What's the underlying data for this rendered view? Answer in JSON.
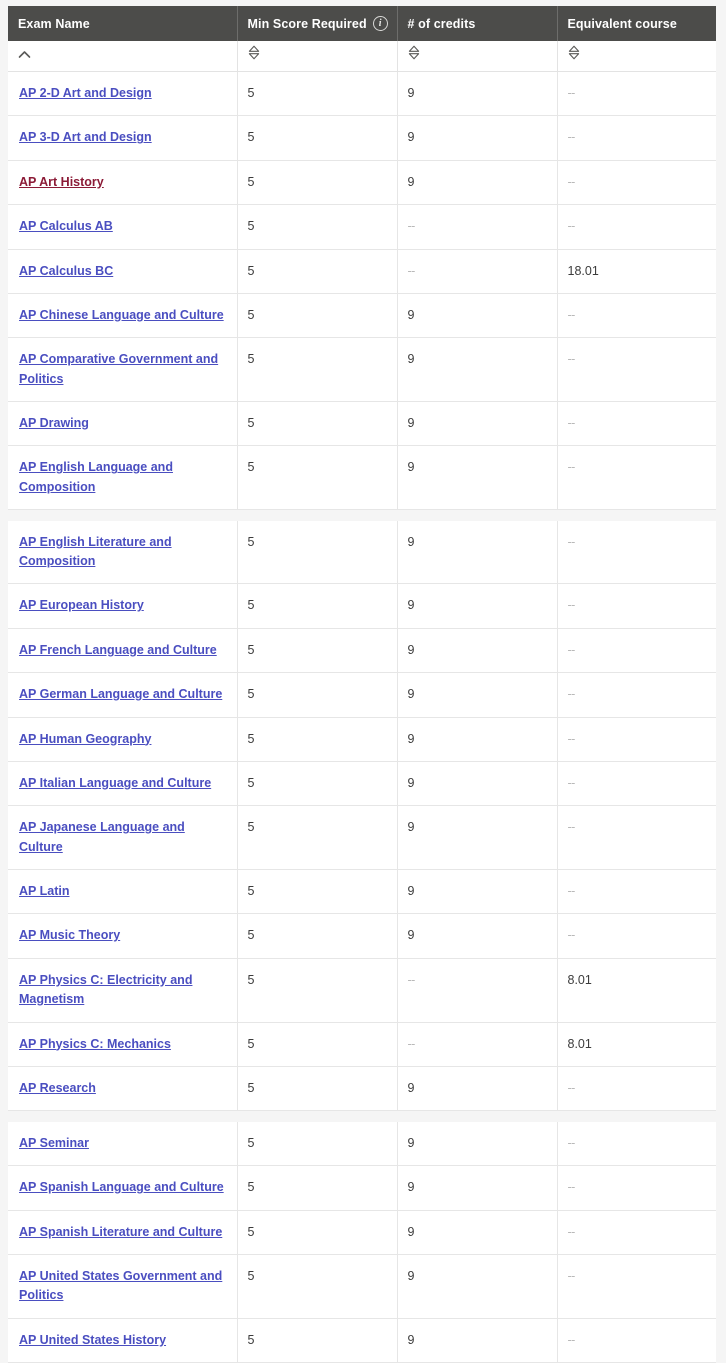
{
  "table": {
    "columns": [
      {
        "label": "Exam Name",
        "sort_icon": "caret-up-icon",
        "sort_state": "ascending",
        "has_info_icon": false
      },
      {
        "label": "Min Score Required",
        "sort_icon": "sort-both-icon",
        "sort_state": "none",
        "has_info_icon": true,
        "info_icon": "info-circle-icon"
      },
      {
        "label": "# of credits",
        "sort_icon": "sort-both-icon",
        "sort_state": "none",
        "has_info_icon": false
      },
      {
        "label": "Equivalent course",
        "sort_icon": "sort-both-icon",
        "sort_state": "none",
        "has_info_icon": false
      }
    ],
    "colors": {
      "header_background": "#4c4c4a",
      "header_text": "#ffffff",
      "link": "#4a4ec0",
      "link_visited": "#8b1a36",
      "cell_text": "#3c3c3c",
      "dash": "#b9b9b9",
      "page_background": "#f5f5f5",
      "row_border": "#e6e6e6"
    },
    "blocks": [
      {
        "rows": [
          {
            "exam": "AP 2-D Art and Design",
            "visited": false,
            "min_score": "5",
            "credits": "9",
            "equivalent": "--"
          },
          {
            "exam": "AP 3-D Art and Design",
            "visited": false,
            "min_score": "5",
            "credits": "9",
            "equivalent": "--"
          },
          {
            "exam": "AP Art History",
            "visited": true,
            "min_score": "5",
            "credits": "9",
            "equivalent": "--"
          },
          {
            "exam": "AP Calculus AB",
            "visited": false,
            "min_score": "5",
            "credits": "--",
            "equivalent": "--"
          },
          {
            "exam": "AP Calculus BC",
            "visited": false,
            "min_score": "5",
            "credits": "--",
            "equivalent": "18.01"
          },
          {
            "exam": "AP Chinese Language and Culture",
            "visited": false,
            "min_score": "5",
            "credits": "9",
            "equivalent": "--"
          },
          {
            "exam": "AP Comparative Government and Politics",
            "visited": false,
            "min_score": "5",
            "credits": "9",
            "equivalent": "--"
          },
          {
            "exam": "AP Drawing",
            "visited": false,
            "min_score": "5",
            "credits": "9",
            "equivalent": "--"
          },
          {
            "exam": "AP English Language and Composition",
            "visited": false,
            "min_score": "5",
            "credits": "9",
            "equivalent": "--"
          }
        ]
      },
      {
        "rows": [
          {
            "exam": "AP English Literature and Composition",
            "visited": false,
            "min_score": "5",
            "credits": "9",
            "equivalent": "--"
          },
          {
            "exam": "AP European History",
            "visited": false,
            "min_score": "5",
            "credits": "9",
            "equivalent": "--"
          },
          {
            "exam": "AP French Language and Culture",
            "visited": false,
            "min_score": "5",
            "credits": "9",
            "equivalent": "--"
          },
          {
            "exam": "AP German Language and Culture",
            "visited": false,
            "min_score": "5",
            "credits": "9",
            "equivalent": "--"
          },
          {
            "exam": "AP Human Geography",
            "visited": false,
            "min_score": "5",
            "credits": "9",
            "equivalent": "--"
          },
          {
            "exam": "AP Italian Language and Culture",
            "visited": false,
            "min_score": "5",
            "credits": "9",
            "equivalent": "--"
          },
          {
            "exam": "AP Japanese Language and Culture",
            "visited": false,
            "min_score": "5",
            "credits": "9",
            "equivalent": "--"
          },
          {
            "exam": "AP Latin",
            "visited": false,
            "min_score": "5",
            "credits": "9",
            "equivalent": "--"
          },
          {
            "exam": "AP Music Theory",
            "visited": false,
            "min_score": "5",
            "credits": "9",
            "equivalent": "--"
          },
          {
            "exam": "AP Physics C: Electricity and Magnetism",
            "visited": false,
            "min_score": "5",
            "credits": "--",
            "equivalent": "8.01"
          },
          {
            "exam": "AP Physics C: Mechanics",
            "visited": false,
            "min_score": "5",
            "credits": "--",
            "equivalent": "8.01"
          },
          {
            "exam": "AP Research",
            "visited": false,
            "min_score": "5",
            "credits": "9",
            "equivalent": "--"
          }
        ]
      },
      {
        "rows": [
          {
            "exam": "AP Seminar",
            "visited": false,
            "min_score": "5",
            "credits": "9",
            "equivalent": "--"
          },
          {
            "exam": "AP Spanish Language and Culture",
            "visited": false,
            "min_score": "5",
            "credits": "9",
            "equivalent": "--"
          },
          {
            "exam": "AP Spanish Literature and Culture",
            "visited": false,
            "min_score": "5",
            "credits": "9",
            "equivalent": "--"
          },
          {
            "exam": "AP United States Government and Politics",
            "visited": false,
            "min_score": "5",
            "credits": "9",
            "equivalent": "--"
          },
          {
            "exam": "AP United States History",
            "visited": false,
            "min_score": "5",
            "credits": "9",
            "equivalent": "--"
          }
        ]
      }
    ]
  }
}
